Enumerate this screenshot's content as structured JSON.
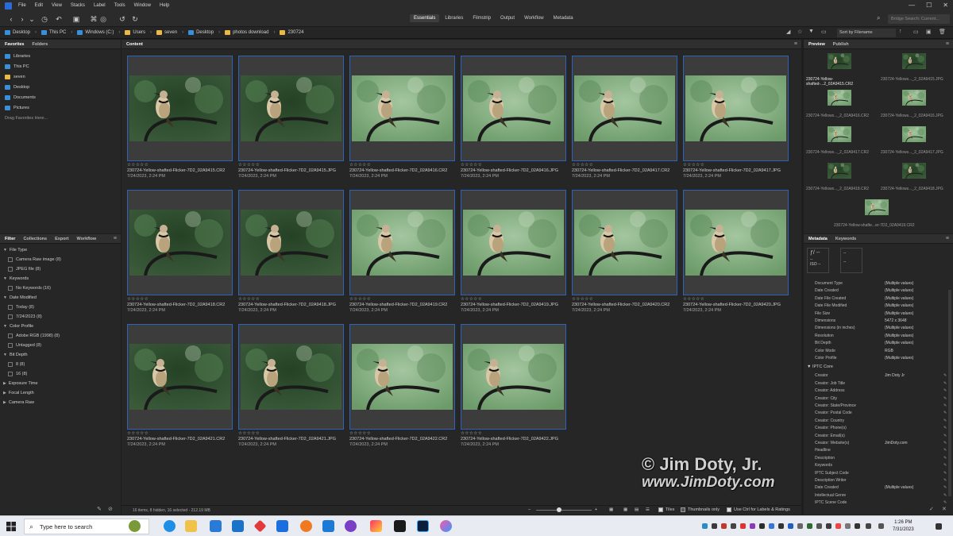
{
  "menubar": {
    "items": [
      "File",
      "Edit",
      "View",
      "Stacks",
      "Label",
      "Tools",
      "Window",
      "Help"
    ]
  },
  "toolbar": {
    "workspaces": [
      "Essentials",
      "Libraries",
      "Filmstrip",
      "Output",
      "Workflow",
      "Metadata"
    ],
    "active_workspace": "Essentials",
    "search_placeholder": "Bridge Search: Current..."
  },
  "path": {
    "crumbs": [
      "Desktop",
      "This PC",
      "Windows (C:)",
      "Users",
      "seven",
      "Desktop",
      "photos download",
      "230724"
    ]
  },
  "sort": {
    "label": "Sort by Filename"
  },
  "favorites": {
    "tabs": [
      "Favorites",
      "Folders"
    ],
    "items": [
      "Libraries",
      "This PC",
      "seven",
      "Desktop",
      "Documents",
      "Pictures"
    ],
    "hint": "Drag Favorites Here..."
  },
  "filter": {
    "tabs": [
      "Filter",
      "Collections",
      "Export",
      "Workflow"
    ],
    "groups": [
      {
        "title": "File Type",
        "items": [
          "Camera Raw image (8)",
          "JPEG file (8)"
        ]
      },
      {
        "title": "Keywords",
        "items": [
          "No Keywords (16)"
        ]
      },
      {
        "title": "Date Modified",
        "items": [
          "Today (8)",
          "7/24/2023 (8)"
        ]
      },
      {
        "title": "Color Profile",
        "items": [
          "Adobe RGB (1998) (8)",
          "Untagged (8)"
        ]
      },
      {
        "title": "Bit Depth",
        "items": [
          "8 (8)",
          "16 (8)"
        ]
      },
      {
        "title": "Exposure Time",
        "items": []
      },
      {
        "title": "Focal Length",
        "items": []
      },
      {
        "title": "Camera Raw",
        "items": []
      }
    ]
  },
  "content": {
    "tab": "Content",
    "stars": "☆☆☆☆☆",
    "thumbnails": [
      {
        "name": "230724-Yellow-shafted-Flicker-7D2_02A9415.CR2",
        "date": "7/24/2023, 2:24 PM"
      },
      {
        "name": "230724-Yellow-shafted-Flicker-7D2_02A9415.JPG",
        "date": "7/24/2023, 2:24 PM"
      },
      {
        "name": "230724-Yellow-shafted-Flicker-7D2_02A9416.CR2",
        "date": "7/24/2023, 2:24 PM"
      },
      {
        "name": "230724-Yellow-shafted-Flicker-7D2_02A9416.JPG",
        "date": "7/24/2023, 2:24 PM"
      },
      {
        "name": "230724-Yellow-shafted-Flicker-7D2_02A9417.CR2",
        "date": "7/24/2023, 2:24 PM"
      },
      {
        "name": "230724-Yellow-shafted-Flicker-7D2_02A9417.JPG",
        "date": "7/24/2023, 2:24 PM"
      },
      {
        "name": "230724-Yellow-shafted-Flicker-7D2_02A9418.CR2",
        "date": "7/24/2023, 2:24 PM"
      },
      {
        "name": "230724-Yellow-shafted-Flicker-7D2_02A9418.JPG",
        "date": "7/24/2023, 2:24 PM"
      },
      {
        "name": "230724-Yellow-shafted-Flicker-7D2_02A9419.CR2",
        "date": "7/24/2023, 2:24 PM"
      },
      {
        "name": "230724-Yellow-shafted-Flicker-7D2_02A9419.JPG",
        "date": "7/24/2023, 2:24 PM"
      },
      {
        "name": "230724-Yellow-shafted-Flicker-7D2_02A9420.CR2",
        "date": "7/24/2023, 2:24 PM"
      },
      {
        "name": "230724-Yellow-shafted-Flicker-7D2_02A9420.JPG",
        "date": "7/24/2023, 2:24 PM"
      },
      {
        "name": "230724-Yellow-shafted-Flicker-7D2_02A9421.CR2",
        "date": "7/24/2023, 2:24 PM"
      },
      {
        "name": "230724-Yellow-shafted-Flicker-7D2_02A9421.JPG",
        "date": "7/24/2023, 2:24 PM"
      },
      {
        "name": "230724-Yellow-shafted-Flicker-7D2_02A9422.CR2",
        "date": "7/24/2023, 2:24 PM"
      },
      {
        "name": "230724-Yellow-shafted-Flicker-7D2_02A9422.JPG",
        "date": "7/24/2023, 2:24 PM"
      }
    ],
    "status": "16 items, 8 hidden, 16 selected - 212.19 MB",
    "tiles_label": "Tiles",
    "thumbs_only_label": "Thumbnails only",
    "ctrl_label": "Use Ctrl for Labels & Ratings"
  },
  "preview": {
    "tabs": [
      "Preview",
      "Publish"
    ],
    "captions": [
      "230724-Yellow-shafted-...2_02A9415.CR2",
      "230724-Yellows..._2_02A9415.JPG",
      "230724-Yellows..._2_02A9416.CR2",
      "230724-Yellows..._2_02A9416.JPG",
      "230724-Yellows..._2_02A9417.CR2",
      "230724-Yellows..._2_02A9417.JPG",
      "230724-Yellows..._2_02A9418.CR2",
      "230724-Yellows..._2_02A9418.JPG",
      "230724-Yellow-shafte...er-7D2_02A9419.CR2"
    ]
  },
  "metadata": {
    "tabs": [
      "Metadata",
      "Keywords"
    ],
    "exif": {
      "f": "ƒ/ --",
      "a": "--",
      "b": "--",
      "c": "--",
      "iso": "ISO --",
      "d": "--",
      "e": "--"
    },
    "file_props": [
      [
        "Document Type",
        "(Multiple values)"
      ],
      [
        "Date Created",
        "(Multiple values)"
      ],
      [
        "Date File Created",
        "(Multiple values)"
      ],
      [
        "Date File Modified",
        "(Multiple values)"
      ],
      [
        "File Size",
        "(Multiple values)"
      ],
      [
        "Dimensions",
        "5472 x 3648"
      ],
      [
        "Dimensions (in inches)",
        "(Multiple values)"
      ],
      [
        "Resolution",
        "(Multiple values)"
      ],
      [
        "Bit Depth",
        "(Multiple values)"
      ],
      [
        "Color Mode",
        "RGB"
      ],
      [
        "Color Profile",
        "(Multiple values)"
      ]
    ],
    "iptc_title": "IPTC Core",
    "iptc": [
      [
        "Creator",
        "Jim Doty Jr"
      ],
      [
        "Creator: Job Title",
        ""
      ],
      [
        "Creator: Address",
        ""
      ],
      [
        "Creator: City",
        ""
      ],
      [
        "Creator: State/Province",
        ""
      ],
      [
        "Creator: Postal Code",
        ""
      ],
      [
        "Creator: Country",
        ""
      ],
      [
        "Creator: Phone(s)",
        ""
      ],
      [
        "Creator: Email(s)",
        ""
      ],
      [
        "Creator: Website(s)",
        "JimDoty.com"
      ],
      [
        "Headline",
        ""
      ],
      [
        "Description",
        ""
      ],
      [
        "Keywords",
        ""
      ],
      [
        "IPTC Subject Code",
        ""
      ],
      [
        "Description Writer",
        ""
      ],
      [
        "Date Created",
        "(Multiple values)"
      ],
      [
        "Intellectual Genre",
        ""
      ],
      [
        "IPTC Scene Code",
        ""
      ]
    ]
  },
  "watermark": {
    "line1": "© Jim Doty, Jr.",
    "line2": "www.JimDoty.com"
  },
  "taskbar": {
    "search_placeholder": "Type here to search",
    "time": "1:26 PM",
    "date": "7/31/2023"
  }
}
